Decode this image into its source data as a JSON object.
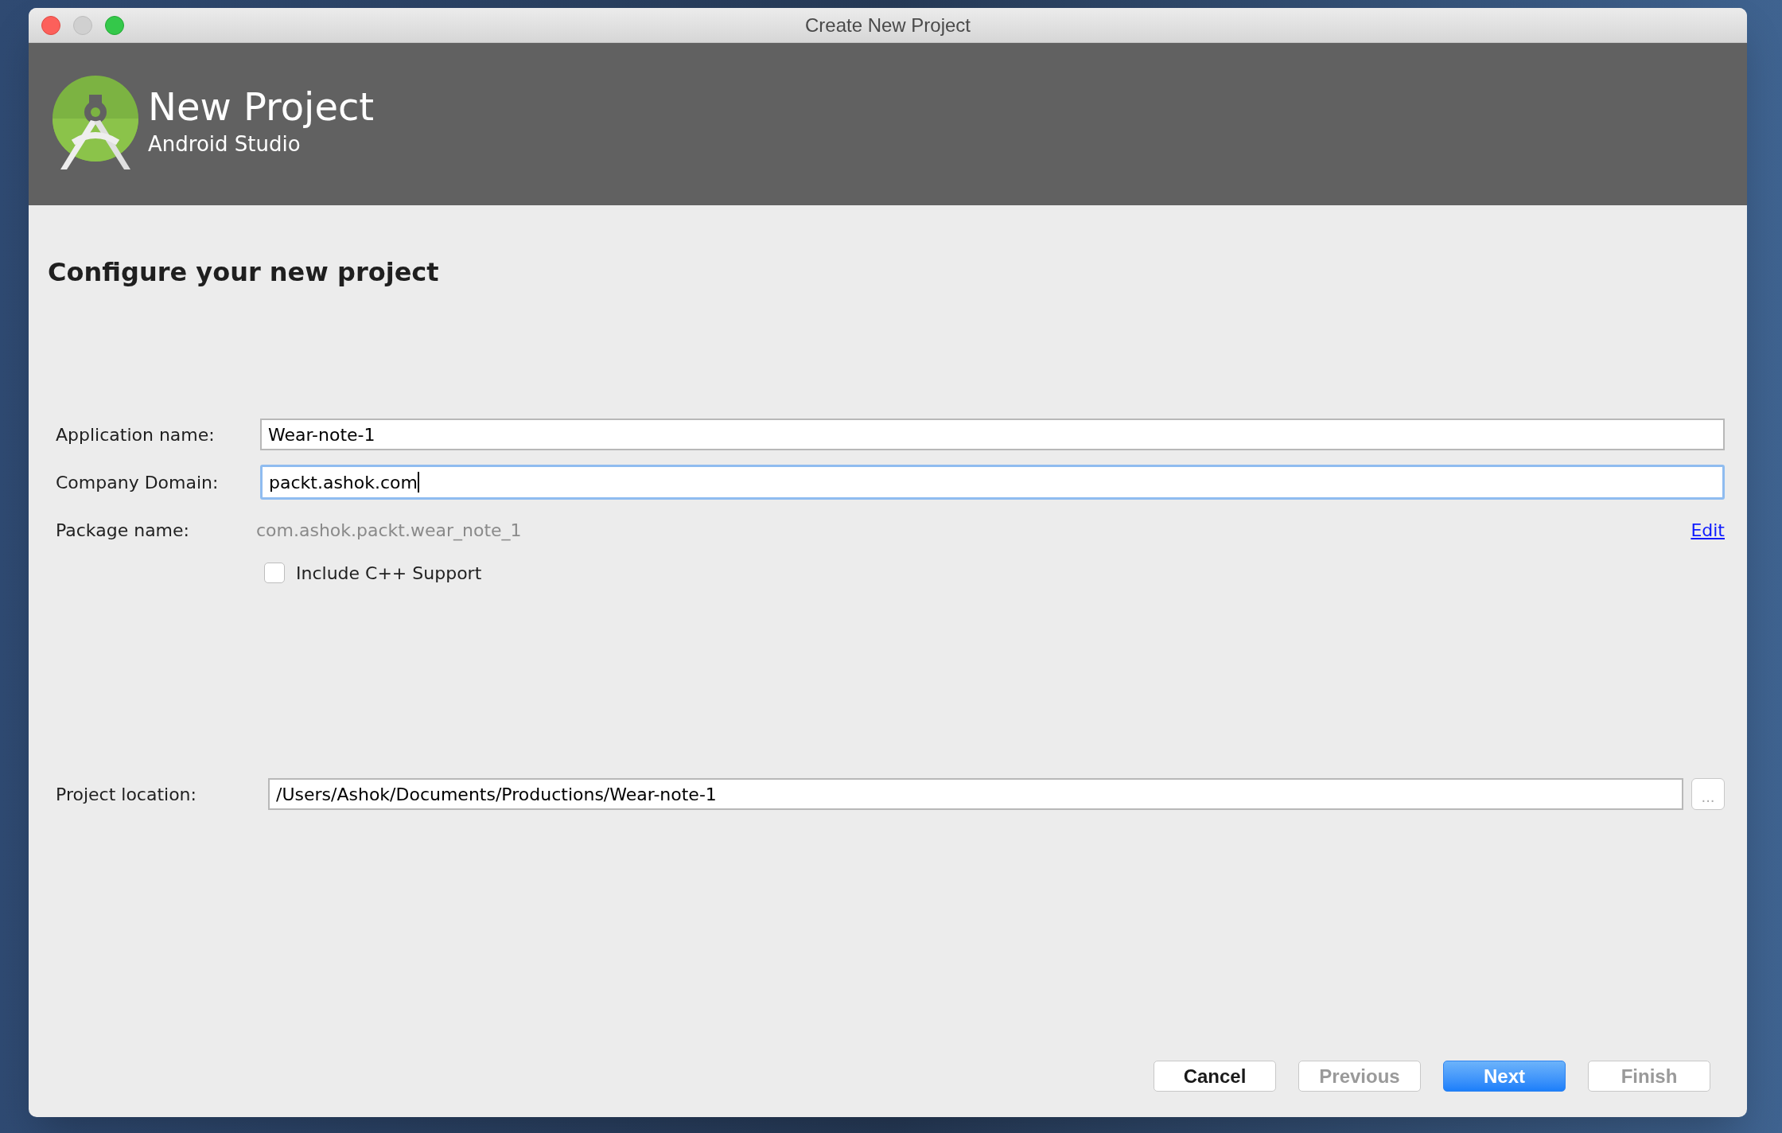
{
  "window": {
    "title": "Create New Project"
  },
  "header": {
    "title": "New Project",
    "subtitle": "Android Studio"
  },
  "heading": "Configure your new project",
  "fields": [
    {
      "label": "Application name:",
      "value": "Wear-note-1",
      "focused": false
    },
    {
      "label": "Company Domain:",
      "value": "packt.ashok.com",
      "focused": true
    }
  ],
  "package": {
    "label": "Package name:",
    "value": "com.ashok.packt.wear_note_1",
    "link": "Edit"
  },
  "cpp_checkbox": {
    "label": "Include C++ Support",
    "checked": false
  },
  "location": {
    "label": "Project location:",
    "value": "/Users/Ashok/Documents/Productions/Wear-note-1",
    "browse": "..."
  },
  "buttons": [
    {
      "label": "Cancel",
      "disabled": false,
      "default": false
    },
    {
      "label": "Previous",
      "disabled": true,
      "default": false
    },
    {
      "label": "Next",
      "disabled": false,
      "default": true
    },
    {
      "label": "Finish",
      "disabled": true,
      "default": false
    }
  ]
}
